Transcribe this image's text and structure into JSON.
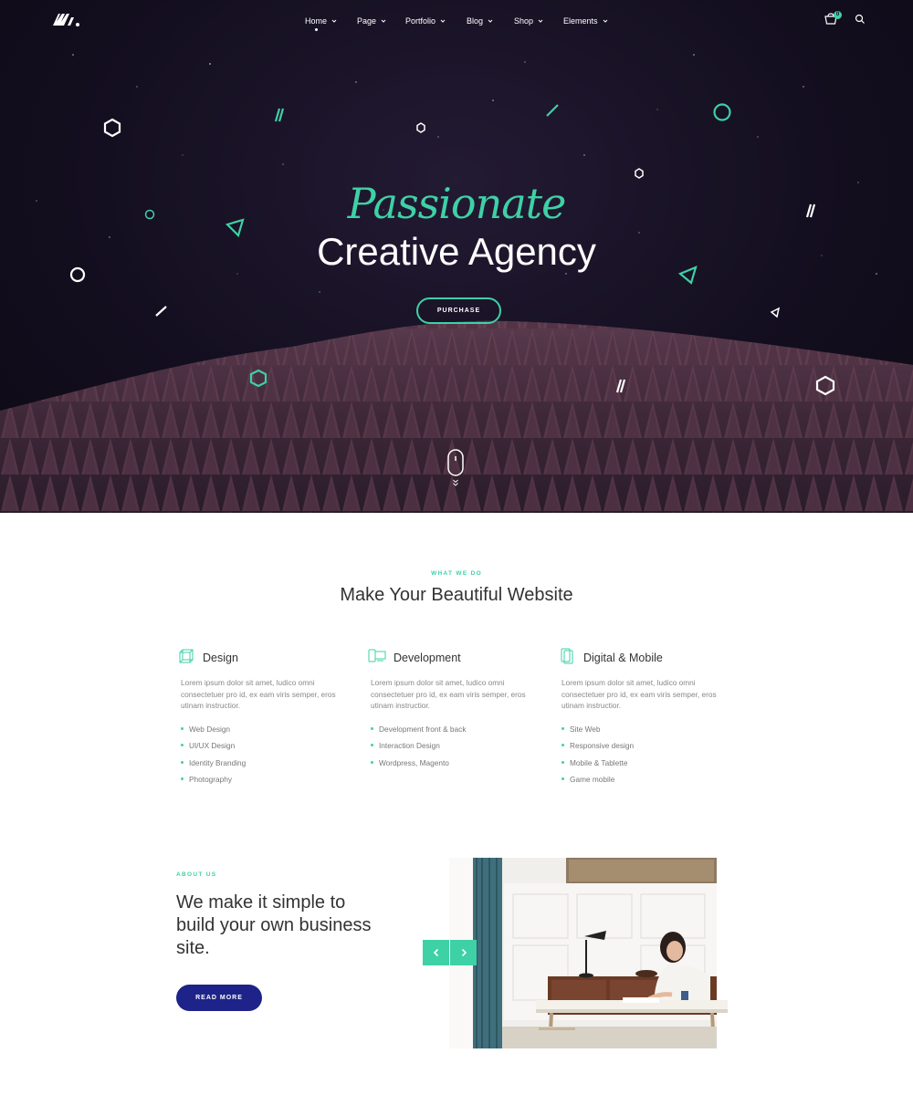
{
  "colors": {
    "accent": "#3ed1a6",
    "hero_bg": "#140f20",
    "button_navy": "#1d2388",
    "heading": "#333333"
  },
  "header": {
    "logo_icon": "brand-m-logo",
    "nav": [
      {
        "label": "Home",
        "active": true
      },
      {
        "label": "Page"
      },
      {
        "label": "Portfolio"
      },
      {
        "label": "Blog"
      },
      {
        "label": "Shop"
      },
      {
        "label": "Elements"
      }
    ],
    "cart_icon": "cart-icon",
    "cart_count": "0",
    "search_icon": "search-icon"
  },
  "hero": {
    "subtitle": "Passionate",
    "title": "Creative Agency",
    "button": "PURCHASE",
    "scroll_icon": "mouse-scroll-icon"
  },
  "services": {
    "kicker": "WHAT WE DO",
    "title": "Make Your Beautiful Website",
    "items": [
      {
        "icon": "cube-icon",
        "title": "Design",
        "text": "Lorem ipsum dolor sit amet, ludico omni consectetuer pro id, ex eam viris semper, eros utinam instructior.",
        "list": [
          "Web Design",
          "UI/UX Design",
          "Identity Branding",
          "Photography"
        ]
      },
      {
        "icon": "devices-icon",
        "title": "Development",
        "text": "Lorem ipsum dolor sit amet, ludico omni consectetuer pro id, ex eam viris semper, eros utinam instructior.",
        "list": [
          "Development front & back",
          "Interaction Design",
          "Wordpress, Magento"
        ]
      },
      {
        "icon": "mobile-icon",
        "title": "Digital & Mobile",
        "text": "Lorem ipsum dolor sit amet, ludico omni consectetuer pro id, ex eam viris semper, eros utinam instructior.",
        "list": [
          "Site Web",
          "Responsive design",
          "Mobile & Tablette",
          "Game mobile"
        ]
      }
    ]
  },
  "about": {
    "kicker": "ABOUT US",
    "title": "We make it simple to build your own business site.",
    "button": "READ MORE",
    "prev_icon": "chevron-left-icon",
    "next_icon": "chevron-right-icon",
    "image": "woman-writing-at-desk-photo"
  }
}
